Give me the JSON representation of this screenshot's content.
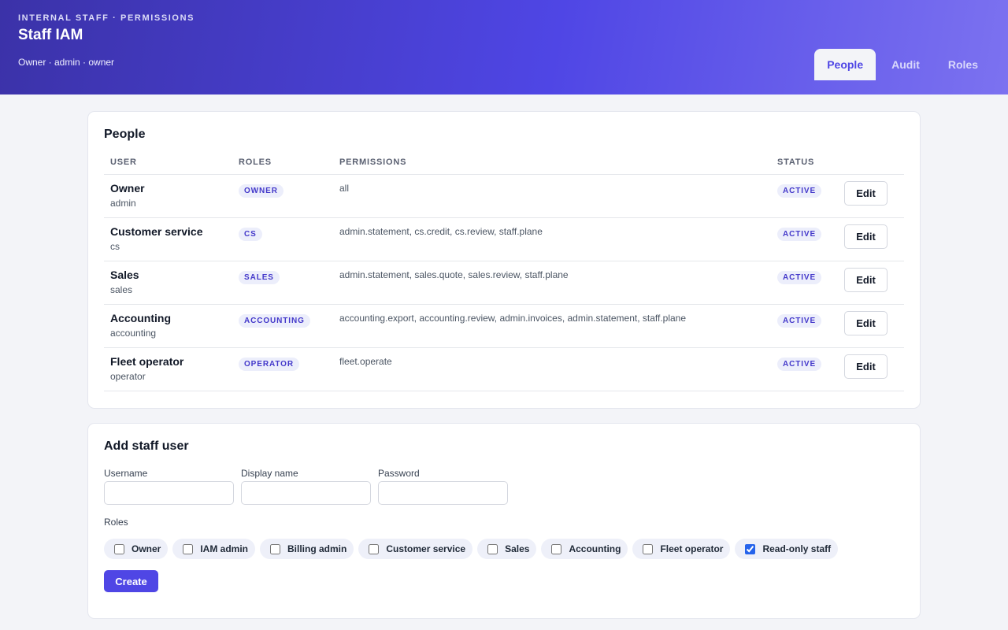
{
  "header": {
    "eyebrow": "INTERNAL STAFF · PERMISSIONS",
    "title": "Staff IAM",
    "user_meta": "Owner · admin · owner",
    "tabs": [
      {
        "label": "People",
        "active": true
      },
      {
        "label": "Audit",
        "active": false
      },
      {
        "label": "Roles",
        "active": false
      }
    ]
  },
  "people": {
    "title": "People",
    "columns": {
      "user": "USER",
      "roles": "ROLES",
      "permissions": "PERMISSIONS",
      "status": "STATUS"
    },
    "rows": [
      {
        "name": "Owner",
        "handle": "admin",
        "role": "OWNER",
        "permissions": "all",
        "status": "ACTIVE",
        "action": "Edit"
      },
      {
        "name": "Customer service",
        "handle": "cs",
        "role": "CS",
        "permissions": "admin.statement, cs.credit, cs.review, staff.plane",
        "status": "ACTIVE",
        "action": "Edit"
      },
      {
        "name": "Sales",
        "handle": "sales",
        "role": "SALES",
        "permissions": "admin.statement, sales.quote, sales.review, staff.plane",
        "status": "ACTIVE",
        "action": "Edit"
      },
      {
        "name": "Accounting",
        "handle": "accounting",
        "role": "ACCOUNTING",
        "permissions": "accounting.export, accounting.review, admin.invoices, admin.statement, staff.plane",
        "status": "ACTIVE",
        "action": "Edit"
      },
      {
        "name": "Fleet operator",
        "handle": "operator",
        "role": "OPERATOR",
        "permissions": "fleet.operate",
        "status": "ACTIVE",
        "action": "Edit"
      }
    ]
  },
  "add_user": {
    "title": "Add staff user",
    "username_label": "Username",
    "username_value": "",
    "display_name_label": "Display name",
    "display_name_value": "",
    "password_label": "Password",
    "password_value": "",
    "roles_label": "Roles",
    "roles": [
      {
        "label": "Owner",
        "checked": false
      },
      {
        "label": "IAM admin",
        "checked": false
      },
      {
        "label": "Billing admin",
        "checked": false
      },
      {
        "label": "Customer service",
        "checked": false
      },
      {
        "label": "Sales",
        "checked": false
      },
      {
        "label": "Accounting",
        "checked": false
      },
      {
        "label": "Fleet operator",
        "checked": false
      },
      {
        "label": "Read-only staff",
        "checked": true
      }
    ],
    "create_label": "Create"
  },
  "colors": {
    "accent": "#4f46e5",
    "header_gradient_start": "#3b32a8",
    "header_gradient_end": "#7c72f0",
    "pill_bg": "#eceefb",
    "pill_text": "#4338ca",
    "page_bg": "#f3f4f8"
  }
}
